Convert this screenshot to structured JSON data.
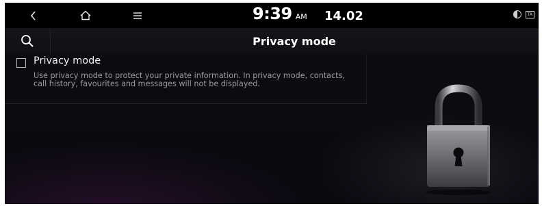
{
  "status_bar": {
    "time": "9:39",
    "ampm": "AM",
    "date": "14.02",
    "ta_label": "TA"
  },
  "header": {
    "title": "Privacy mode"
  },
  "settings": {
    "option_label": "Privacy mode",
    "option_checked": false,
    "option_description": "Use privacy mode to protect your private information. In privacy mode, contacts, call history, favourites and messages will not be displayed."
  },
  "icons": {
    "back": "back-icon",
    "home": "home-icon",
    "menu": "menu-icon",
    "search": "search-icon",
    "brightness": "brightness-icon",
    "lock": "padlock-image"
  }
}
